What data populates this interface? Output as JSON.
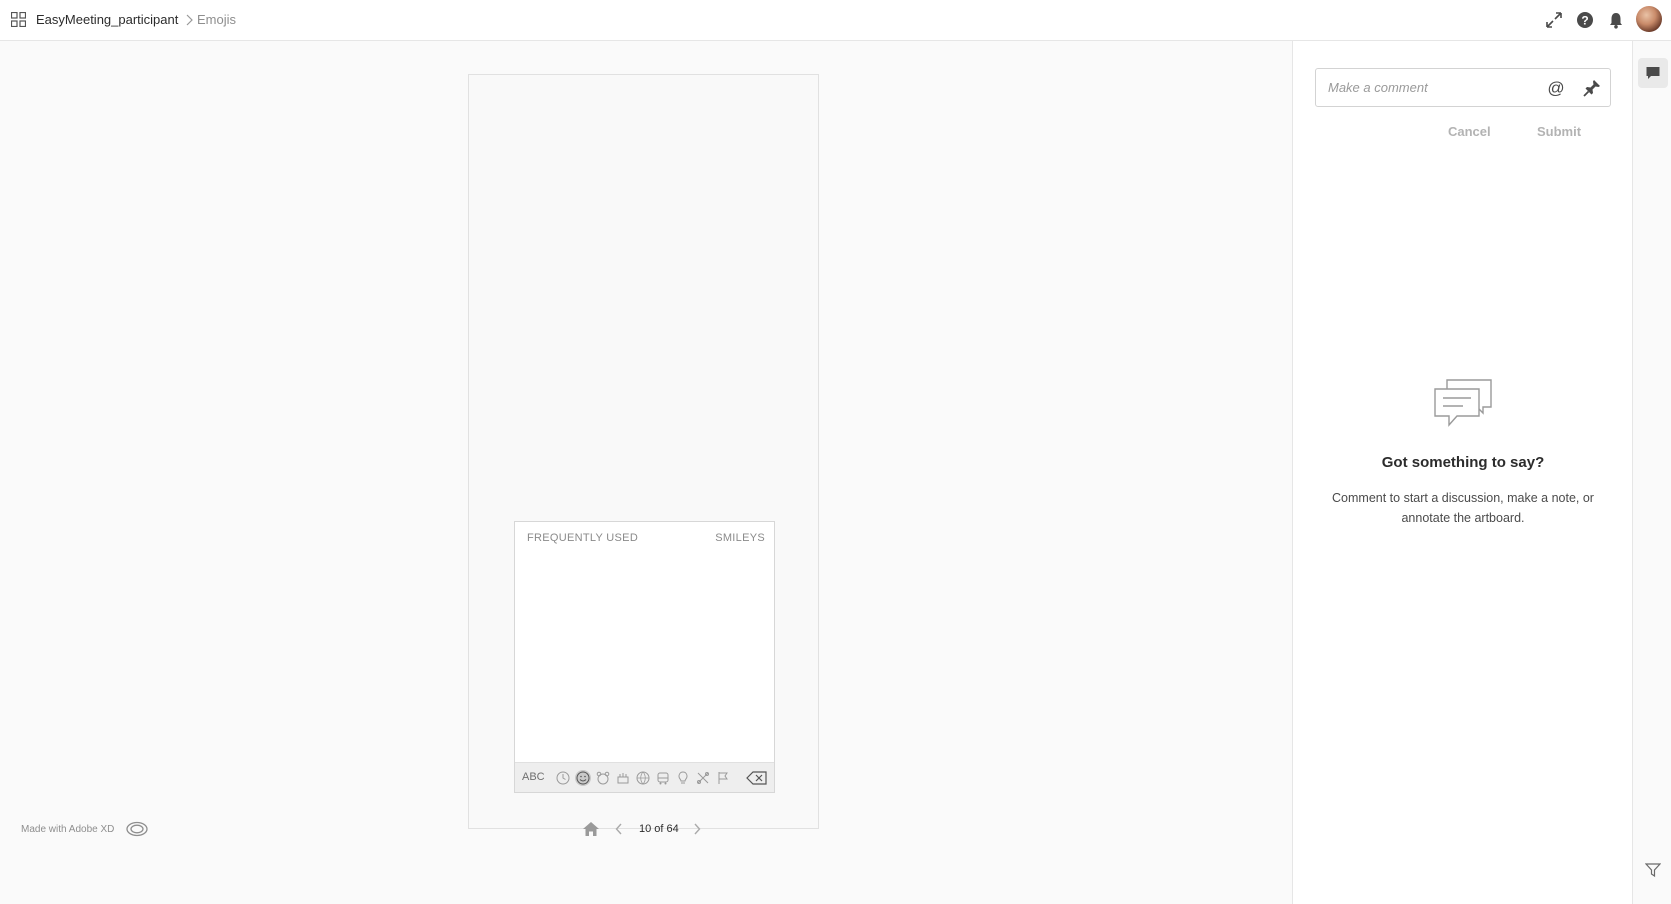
{
  "header": {
    "project_name": "EasyMeeting_participant",
    "current_artboard": "Emojis",
    "icons": [
      "grid-icon",
      "chevron-right-icon",
      "fullscreen-icon",
      "help-icon",
      "bell-icon",
      "avatar"
    ]
  },
  "artboard": {
    "keyboard": {
      "section_left": "FREQUENTLY USED",
      "section_right": "SMILEYS",
      "abc_label": "ABC",
      "categories": [
        "recent-icon",
        "smiley-icon",
        "animal-icon",
        "food-icon",
        "sports-icon",
        "travel-icon",
        "objects-icon",
        "symbols-icon",
        "flag-icon"
      ],
      "active_category": "smiley-icon"
    }
  },
  "footer": {
    "made_with": "Made with Adobe XD",
    "page_counter": "10 of 64"
  },
  "comments": {
    "placeholder": "Make a comment",
    "cancel_label": "Cancel",
    "submit_label": "Submit",
    "empty_title": "Got something to say?",
    "empty_text": "Comment to start a discussion, make a note, or annotate the artboard."
  },
  "colors": {
    "accent_disabled": "#b3b3b3",
    "panel_bg": "#ffffff",
    "canvas_bg": "#fafafa"
  }
}
